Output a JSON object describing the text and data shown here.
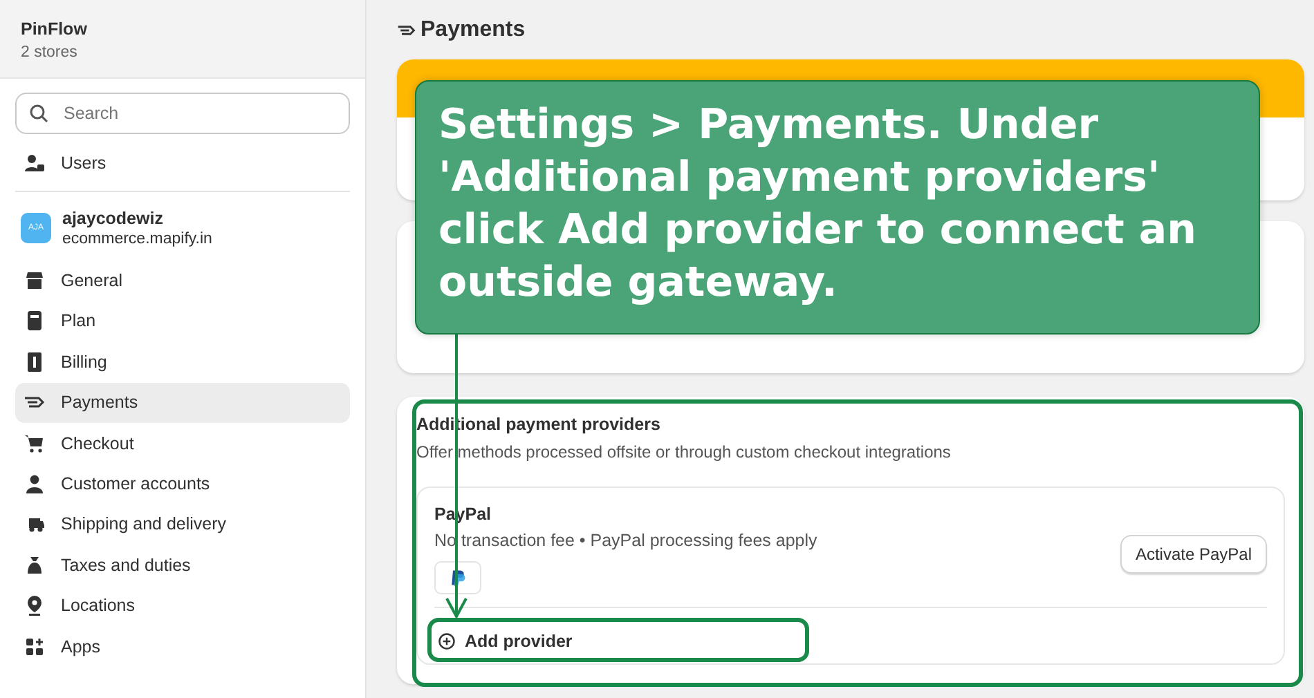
{
  "sidebar": {
    "org": {
      "name": "PinFlow",
      "subtitle": "2 stores"
    },
    "search": {
      "placeholder": "Search"
    },
    "users_label": "Users",
    "store": {
      "initials": "AJA",
      "name": "ajaycodewiz",
      "domain": "ecommerce.mapify.in"
    },
    "items": [
      {
        "label": "General",
        "selected": false
      },
      {
        "label": "Plan",
        "selected": false
      },
      {
        "label": "Billing",
        "selected": false
      },
      {
        "label": "Payments",
        "selected": true
      },
      {
        "label": "Checkout",
        "selected": false
      },
      {
        "label": "Customer accounts",
        "selected": false
      },
      {
        "label": "Shipping and delivery",
        "selected": false
      },
      {
        "label": "Taxes and duties",
        "selected": false
      },
      {
        "label": "Locations",
        "selected": false
      },
      {
        "label": "Apps",
        "selected": false
      }
    ]
  },
  "page_title": "Payments",
  "additional_providers": {
    "title": "Additional payment providers",
    "subtitle": "Offer methods processed offsite or through custom checkout integrations",
    "provider": {
      "name": "PayPal",
      "details": "No transaction fee • PayPal processing fees apply",
      "button": "Activate PayPal"
    },
    "add_button": "Add provider"
  },
  "callout": {
    "text": "Settings > Payments. Under 'Additional payment providers' click Add provider to connect an outside gateway."
  }
}
